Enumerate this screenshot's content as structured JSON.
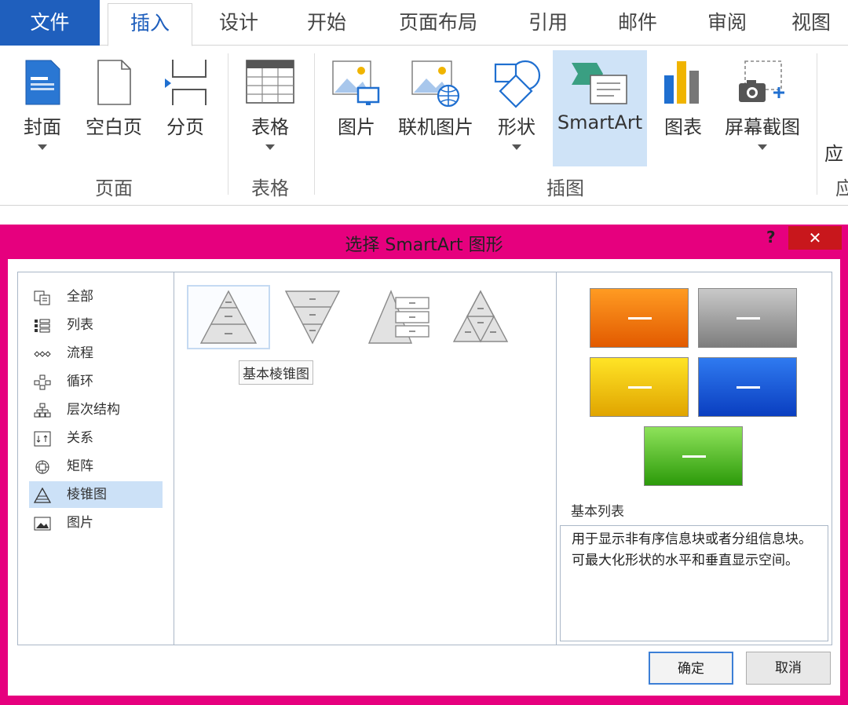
{
  "ribbon": {
    "tabs": {
      "file": "文件",
      "insert": "插入",
      "design": "设计",
      "start": "开始",
      "layout": "页面布局",
      "ref": "引用",
      "mail": "邮件",
      "review": "审阅",
      "view": "视图"
    },
    "buttons": {
      "cover": "封面",
      "blank": "空白页",
      "pagebreak": "分页",
      "table": "表格",
      "picture": "图片",
      "online": "联机图片",
      "shapes": "形状",
      "smartart": "SmartArt",
      "chart": "图表",
      "screenshot": "屏幕截图",
      "apps": "应"
    },
    "groups": {
      "pages": "页面",
      "tables": "表格",
      "illus": "插图",
      "apps": "应"
    }
  },
  "dialog": {
    "title": "选择 SmartArt 图形",
    "help": "?",
    "close": "✕",
    "categories": [
      "全部",
      "列表",
      "流程",
      "循环",
      "层次结构",
      "关系",
      "矩阵",
      "棱锥图",
      "图片"
    ],
    "tooltip": "基本棱锥图",
    "preview_title": "基本列表",
    "description": "用于显示非有序信息块或者分组信息块。可最大化形状的水平和垂直显示空间。",
    "ok": "确定",
    "cancel": "取消"
  }
}
